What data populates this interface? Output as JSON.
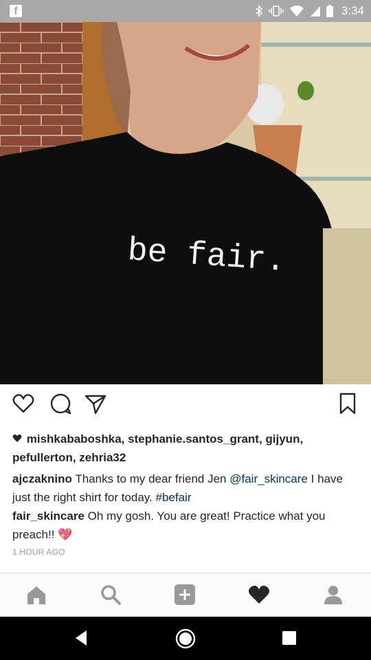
{
  "status_bar": {
    "app_icon": "facebook-icon",
    "icons": [
      "bluetooth-icon",
      "vibrate-icon",
      "wifi-icon",
      "signal-icon",
      "battery-icon"
    ],
    "time": "3:34"
  },
  "post": {
    "photo": {
      "shirt_text": "be fair."
    },
    "actions": [
      "heart-icon",
      "comment-icon",
      "share-icon",
      "bookmark-icon"
    ],
    "likes": {
      "icon": "heart-small-icon",
      "text": "mishkababoshka, stephanie.santos_grant, gijyun, pefullerton, zehria32"
    },
    "caption": {
      "username": "ajczaknino",
      "text_before": "Thanks to my dear friend Jen",
      "mention": "@fair_skincare",
      "text_after": "I have just the right shirt for today.",
      "hashtag": "#befair"
    },
    "comment": {
      "username": "fair_skincare",
      "text": "Oh my gosh. You are great! Practice what you preach!!",
      "emoji": "💖"
    },
    "timestamp": "1 HOUR AGO"
  },
  "bottom_nav": {
    "items": [
      {
        "name": "home",
        "icon": "home-icon",
        "active": false
      },
      {
        "name": "search",
        "icon": "search-icon",
        "active": false
      },
      {
        "name": "add",
        "icon": "add-icon",
        "active": false
      },
      {
        "name": "activity",
        "icon": "heart-icon",
        "active": true
      },
      {
        "name": "profile",
        "icon": "profile-icon",
        "active": false
      }
    ]
  },
  "android_nav": [
    "back-icon",
    "home-circle-icon",
    "recents-icon"
  ],
  "colors": {
    "link": "#003569",
    "status_bar": "#a9a9a9",
    "inactive_nav": "#999999",
    "active_nav": "#262626"
  }
}
